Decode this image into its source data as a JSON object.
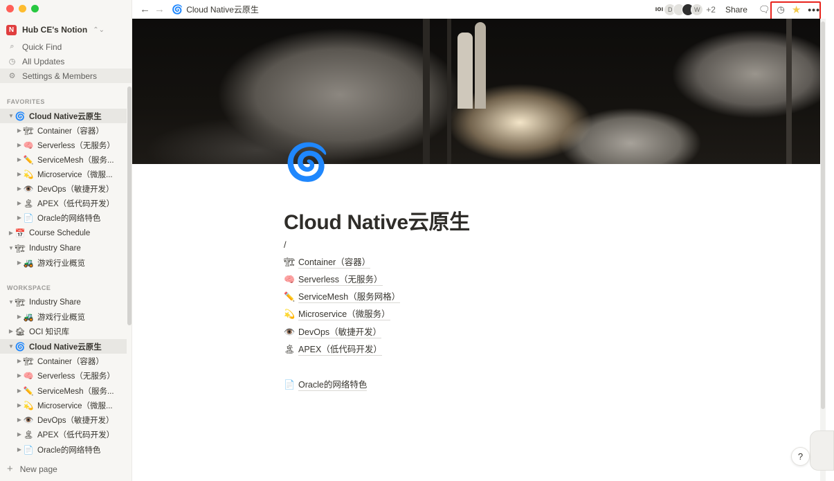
{
  "window": {
    "traffic_lights": [
      "close",
      "minimize",
      "zoom"
    ]
  },
  "sidebar": {
    "workspace_name": "Hub CE's Notion",
    "workspace_logo": "N",
    "nav": [
      {
        "icon": "search-icon",
        "glyph": "⌕",
        "label": "Quick Find"
      },
      {
        "icon": "clock-icon",
        "glyph": "◷",
        "label": "All Updates"
      },
      {
        "icon": "gear-icon",
        "glyph": "⚙",
        "label": "Settings & Members"
      }
    ],
    "favorites_label": "FAVORITES",
    "workspace_label": "WORKSPACE",
    "new_page_label": "New page",
    "favorites": [
      {
        "caret": "▼",
        "emoji": "🌀",
        "label": "Cloud Native云原生",
        "selected": true
      },
      {
        "caret": "▶",
        "emoji": "🏗",
        "label": "Container（容器）"
      },
      {
        "caret": "▶",
        "emoji": "🧠",
        "label": "Serverless（无服务）"
      },
      {
        "caret": "▶",
        "emoji": "✏️",
        "label": "ServiceMesh（服务..."
      },
      {
        "caret": "▶",
        "emoji": "💫",
        "label": "Microservice（微服..."
      },
      {
        "caret": "▶",
        "emoji": "👁️",
        "label": "DevOps（敏捷开发）"
      },
      {
        "caret": "▶",
        "emoji": "🏝",
        "label": "APEX（低代码开发）"
      },
      {
        "caret": "▶",
        "emoji": "📄",
        "label": "Oracle的网络特色"
      },
      {
        "caret": "▶",
        "emoji": "📅",
        "label": "Course Schedule"
      },
      {
        "caret": "▼",
        "emoji": "🏗",
        "label": "Industry Share"
      },
      {
        "caret": "▶",
        "emoji": "🚜",
        "label": "游戏行业概览"
      }
    ],
    "workspace": [
      {
        "caret": "▼",
        "emoji": "🏗",
        "label": "Industry Share"
      },
      {
        "caret": "▶",
        "emoji": "🚜",
        "label": "游戏行业概览"
      },
      {
        "caret": "▶",
        "emoji": "🏚",
        "label": "OCI 知识库"
      },
      {
        "caret": "▼",
        "emoji": "🌀",
        "label": "Cloud Native云原生",
        "selected": true
      },
      {
        "caret": "▶",
        "emoji": "🏗",
        "label": "Container（容器）"
      },
      {
        "caret": "▶",
        "emoji": "🧠",
        "label": "Serverless（无服务）"
      },
      {
        "caret": "▶",
        "emoji": "✏️",
        "label": "ServiceMesh（服务..."
      },
      {
        "caret": "▶",
        "emoji": "💫",
        "label": "Microservice（微服..."
      },
      {
        "caret": "▶",
        "emoji": "👁️",
        "label": "DevOps（敏捷开发）"
      },
      {
        "caret": "▶",
        "emoji": "🏝",
        "label": "APEX（低代码开发）"
      },
      {
        "caret": "▶",
        "emoji": "📄",
        "label": "Oracle的网络特色"
      }
    ]
  },
  "topbar": {
    "back": "←",
    "forward": "→",
    "breadcrumb_icon": "🌀",
    "breadcrumb": "Cloud Native云原生",
    "presence_glyph": "ıoı",
    "avatars": [
      "D",
      "",
      "",
      "W"
    ],
    "extra_count": "+2",
    "share_label": "Share",
    "comment_glyph": "🗨",
    "updates_glyph": "◷",
    "star_glyph": "★",
    "more_glyph": "•••"
  },
  "page": {
    "icon": "🌀",
    "title": "Cloud Native云原生",
    "slash": "/",
    "links": [
      {
        "emoji": "🏗",
        "label": "Container（容器）"
      },
      {
        "emoji": "🧠",
        "label": "Serverless（无服务）"
      },
      {
        "emoji": "✏️",
        "label": "ServiceMesh（服务网格）"
      },
      {
        "emoji": "💫",
        "label": "Microservice（微服务）"
      },
      {
        "emoji": "👁️",
        "label": "DevOps（敏捷开发）"
      },
      {
        "emoji": "🏝",
        "label": "APEX（低代码开发）"
      }
    ],
    "subpage": {
      "emoji": "📄",
      "label": "Oracle的网络特色"
    }
  },
  "help_label": "?",
  "colors": {
    "sidebar_bg": "#f7f6f3",
    "highlight_box": "#e8221b",
    "star": "#f2c94c",
    "page_icon": "#1f63d6"
  }
}
